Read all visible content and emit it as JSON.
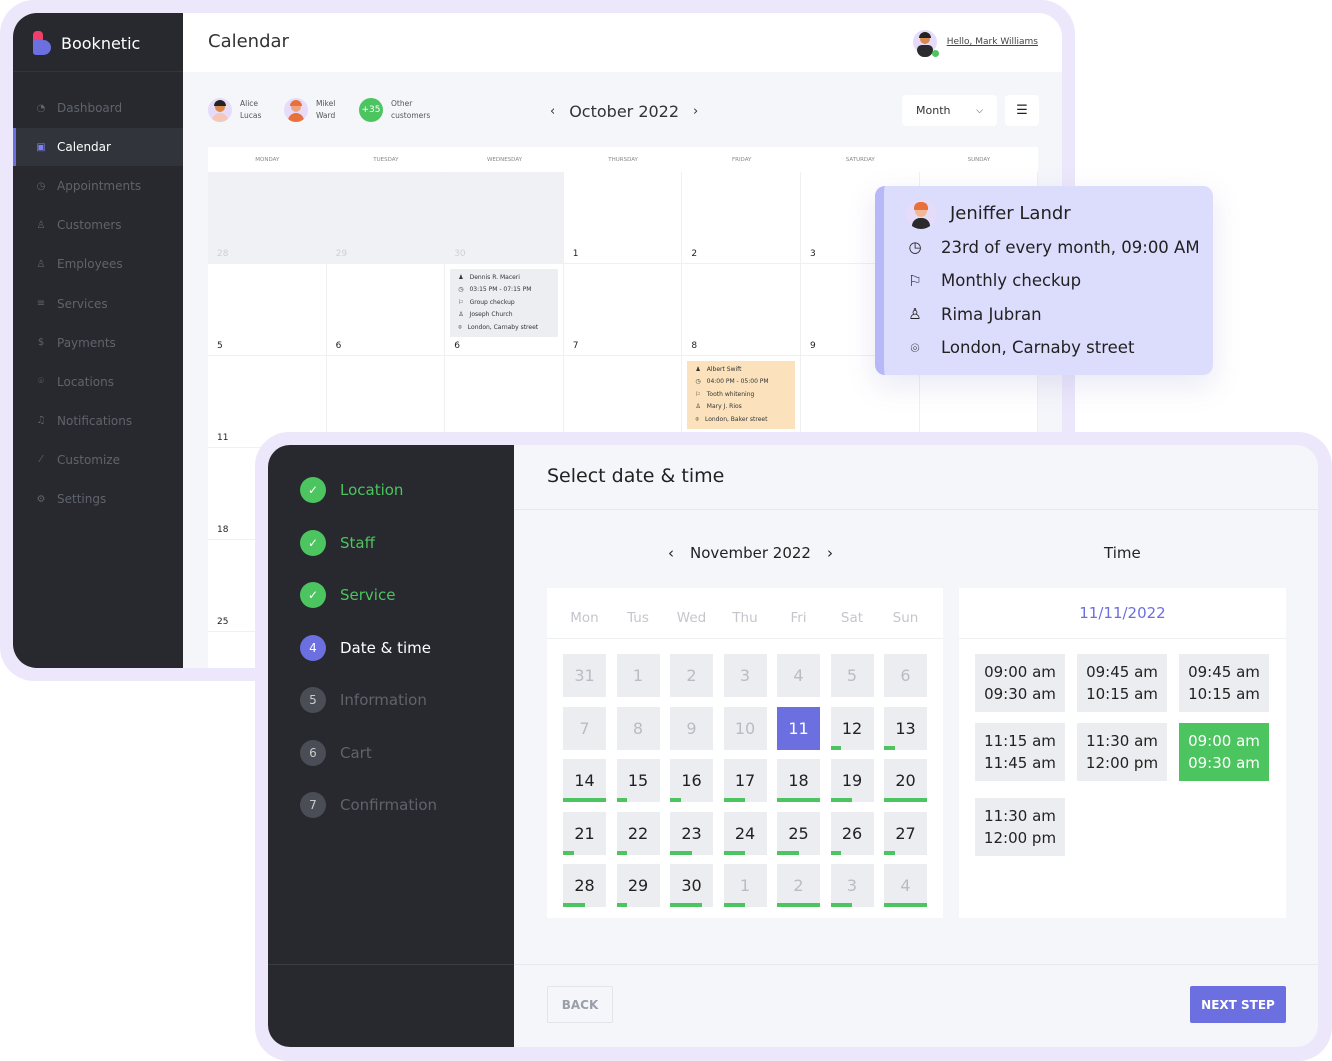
{
  "app": {
    "name": "Booknetic",
    "page_title": "Calendar",
    "greeting": "Hello, Mark Williams"
  },
  "sidebar": {
    "items": [
      {
        "label": "Dashboard",
        "icon": "pie-chart-icon"
      },
      {
        "label": "Calendar",
        "icon": "calendar-icon",
        "active": true
      },
      {
        "label": "Appointments",
        "icon": "clock-icon"
      },
      {
        "label": "Customers",
        "icon": "user-icon"
      },
      {
        "label": "Employees",
        "icon": "users-icon"
      },
      {
        "label": "Services",
        "icon": "list-icon"
      },
      {
        "label": "Payments",
        "icon": "dollar-icon"
      },
      {
        "label": "Locations",
        "icon": "location-pin-icon"
      },
      {
        "label": "Notifications",
        "icon": "bell-icon"
      },
      {
        "label": "Customize",
        "icon": "magic-wand-icon"
      },
      {
        "label": "Settings",
        "icon": "gear-icon"
      }
    ]
  },
  "calendar": {
    "staff": [
      {
        "first": "Alice",
        "last": "Lucas"
      },
      {
        "first": "Mikel",
        "last": "Ward"
      }
    ],
    "others": {
      "count": "+35",
      "line1": "Other",
      "line2": "customers"
    },
    "month": "October 2022",
    "view": "Month",
    "weekdays": [
      "MONDAY",
      "TUESDAY",
      "WEDNESDAY",
      "THURSDAY",
      "FRIDAY",
      "SATURDAY",
      "SUNDAY"
    ],
    "weeks": [
      [
        "28",
        "29",
        "30",
        "1",
        "2",
        "3",
        ""
      ],
      [
        "5",
        "6",
        "6",
        "7",
        "8",
        "9",
        ""
      ],
      [
        "11",
        "",
        "",
        "",
        "",
        "",
        ""
      ],
      [
        "18",
        "",
        "",
        "",
        "",
        "",
        ""
      ],
      [
        "25",
        "",
        "",
        "",
        "",
        "",
        ""
      ]
    ],
    "events": [
      {
        "name": "Dennis R. Maceri",
        "time": "03:15 PM - 07:15 PM",
        "service": "Group checkup",
        "staff": "Joseph Church",
        "location": "London, Carnaby street",
        "color": "#eceef2"
      },
      {
        "name": "Albert Swift",
        "time": "04:00 PM - 05:00 PM",
        "service": "Tooth whitening",
        "staff": "Mary J. Rios",
        "location": "London, Baker street",
        "color": "#fbe2bd"
      }
    ]
  },
  "tooltip": {
    "name": "Jeniffer Landr",
    "schedule": "23rd of every month, 09:00 AM",
    "service": "Monthly checkup",
    "staff": "Rima Jubran",
    "location": "London, Carnaby street"
  },
  "booking": {
    "steps": [
      {
        "num": "1",
        "label": "Location",
        "state": "done"
      },
      {
        "num": "2",
        "label": "Staff",
        "state": "done"
      },
      {
        "num": "3",
        "label": "Service",
        "state": "done"
      },
      {
        "num": "4",
        "label": "Date & time",
        "state": "active"
      },
      {
        "num": "5",
        "label": "Information",
        "state": "todo"
      },
      {
        "num": "6",
        "label": "Cart",
        "state": "todo"
      },
      {
        "num": "7",
        "label": "Confirmation",
        "state": "todo"
      }
    ],
    "title": "Select date & time",
    "month": "November 2022",
    "time_label": "Time",
    "weekdays": [
      "Mon",
      "Tus",
      "Wed",
      "Thu",
      "Fri",
      "Sat",
      "Sun"
    ],
    "days": [
      {
        "d": "31",
        "dim": true
      },
      {
        "d": "1",
        "dim": true
      },
      {
        "d": "2",
        "dim": true
      },
      {
        "d": "3",
        "dim": true
      },
      {
        "d": "4",
        "dim": true
      },
      {
        "d": "5",
        "dim": true
      },
      {
        "d": "6",
        "dim": true
      },
      {
        "d": "7",
        "dim": true
      },
      {
        "d": "8",
        "dim": true
      },
      {
        "d": "9",
        "dim": true
      },
      {
        "d": "10",
        "dim": true
      },
      {
        "d": "11",
        "selected": true
      },
      {
        "d": "12",
        "load": 0.25
      },
      {
        "d": "13",
        "load": 0.25
      },
      {
        "d": "14",
        "load": 1
      },
      {
        "d": "15",
        "load": 0.25
      },
      {
        "d": "16",
        "load": 0.25
      },
      {
        "d": "17",
        "load": 0.5
      },
      {
        "d": "18",
        "load": 1
      },
      {
        "d": "19",
        "load": 0.5
      },
      {
        "d": "20",
        "load": 1
      },
      {
        "d": "21",
        "load": 0.25
      },
      {
        "d": "22",
        "load": 0.25
      },
      {
        "d": "23",
        "load": 0.5
      },
      {
        "d": "24",
        "load": 0.5
      },
      {
        "d": "25",
        "load": 0.5
      },
      {
        "d": "26",
        "load": 0.25
      },
      {
        "d": "27",
        "load": 0.25
      },
      {
        "d": "28",
        "load": 0.5
      },
      {
        "d": "29",
        "load": 0.25
      },
      {
        "d": "30",
        "load": 0.75
      },
      {
        "d": "1",
        "dim": true,
        "load": 0.5
      },
      {
        "d": "2",
        "dim": true,
        "load": 1
      },
      {
        "d": "3",
        "dim": true,
        "load": 0.5
      },
      {
        "d": "4",
        "dim": true,
        "load": 1
      }
    ],
    "selected_date": "11/11/2022",
    "slots": [
      {
        "start": "09:00 am",
        "end": "09:30 am"
      },
      {
        "start": "09:45 am",
        "end": "10:15 am"
      },
      {
        "start": "09:45 am",
        "end": "10:15 am"
      },
      {
        "start": "11:15 am",
        "end": "11:45 am"
      },
      {
        "start": "11:30 am",
        "end": "12:00 pm"
      },
      {
        "start": "09:00 am",
        "end": "09:30 am",
        "selected": true
      },
      {
        "start": "11:30 am",
        "end": "12:00 pm"
      }
    ],
    "back_label": "BACK",
    "next_label": "NEXT STEP"
  },
  "colors": {
    "accent": "#6c6fdf",
    "success": "#4cc45f",
    "sidebar": "#27292e",
    "brand_red": "#ef3e6a"
  }
}
